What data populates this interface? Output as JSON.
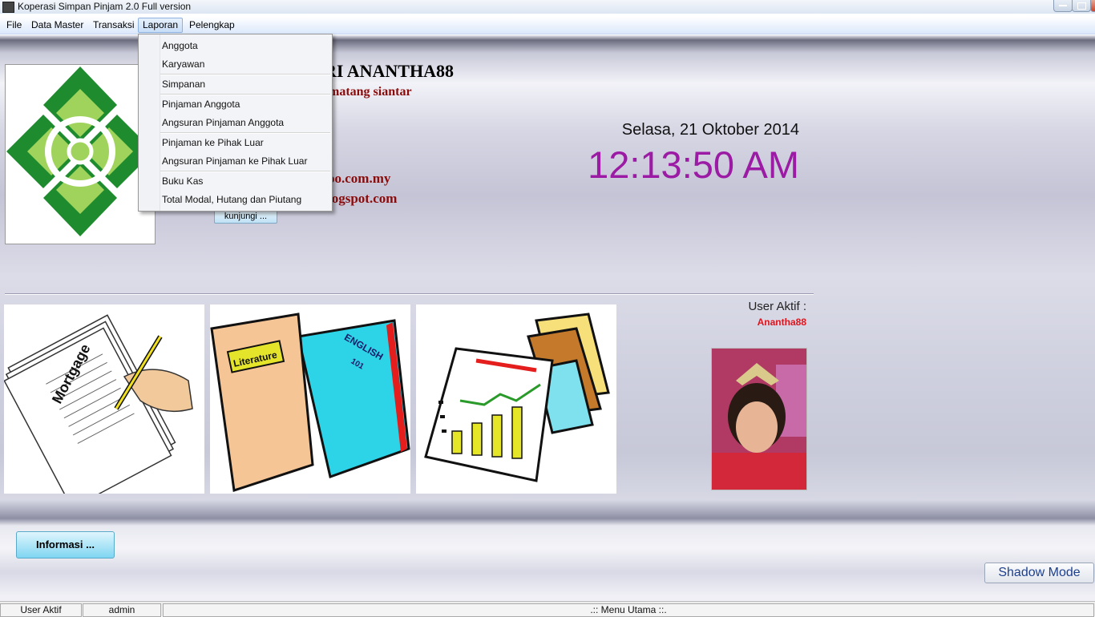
{
  "window": {
    "title": "Koperasi Simpan Pinjam 2.0 Full version",
    "icons": [
      "app-icon",
      "minimize-icon",
      "maximize-icon",
      "close-icon"
    ]
  },
  "menubar": {
    "items": [
      "File",
      "Data Master",
      "Transaksi",
      "Laporan",
      "Pelengkap"
    ],
    "active": "Laporan"
  },
  "laporan_menu": {
    "items": [
      "Anggota",
      "Karyawan",
      "Simpanan",
      "Pinjaman Anggota",
      "Angsuran Pinjaman Anggota",
      "Pinjaman ke Pihak Luar",
      "Angsuran Pinjaman ke Pihak Luar",
      "Buku Kas",
      "Total Modal, Hutang dan Piutang"
    ]
  },
  "header": {
    "org_name": "RI ANANTHA88",
    "org_city": "matang siantar",
    "contact_email": "oo.com.my",
    "contact_blog": "logspot.com",
    "visit_button": "kunjungi ..."
  },
  "datetime": {
    "date": "Selasa,  21 Oktober 2014",
    "time": "12:13:50 AM"
  },
  "user": {
    "label": "User Aktif :",
    "name": "Anantha88"
  },
  "images": {
    "pic1_text": "Mortgage",
    "pic2_text_a": "Literature",
    "pic2_text_b": "ENGLISH",
    "pic2_text_c": "101"
  },
  "buttons": {
    "info": "Informasi ...",
    "shadow": "Shadow Mode"
  },
  "statusbar": {
    "label": "User Aktif",
    "user": "admin",
    "screen": ".:: Menu Utama ::."
  },
  "colors": {
    "clock": "#9c1ba4",
    "user_name": "#e0141c",
    "org_text_red": "#8b0a0a",
    "logo_green_dark": "#1e8c2e",
    "logo_green_light": "#9fd35b"
  }
}
